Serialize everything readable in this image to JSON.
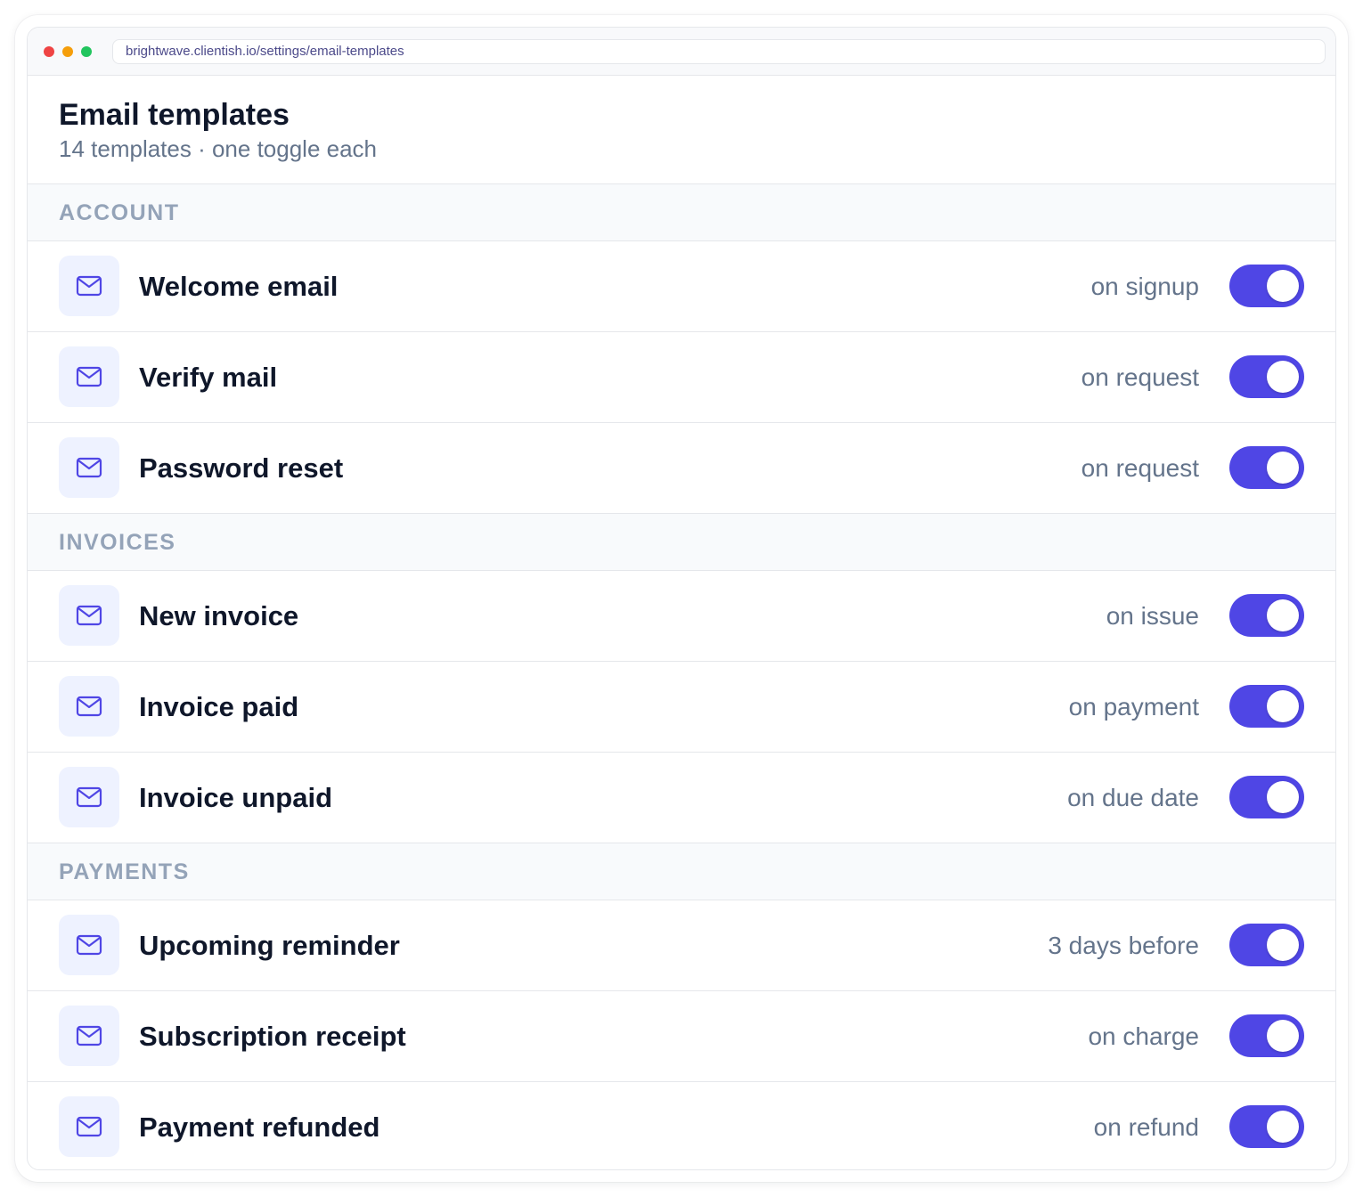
{
  "browser": {
    "url": "brightwave.clientish.io/settings/email-templates"
  },
  "page": {
    "title": "Email templates",
    "subtitle": "14 templates · one toggle each"
  },
  "sections": [
    {
      "name": "ACCOUNT",
      "templates": [
        {
          "name": "Welcome email",
          "trigger": "on signup",
          "enabled": true
        },
        {
          "name": "Verify mail",
          "trigger": "on request",
          "enabled": true
        },
        {
          "name": "Password reset",
          "trigger": "on request",
          "enabled": true
        }
      ]
    },
    {
      "name": "INVOICES",
      "templates": [
        {
          "name": "New invoice",
          "trigger": "on issue",
          "enabled": true
        },
        {
          "name": "Invoice paid",
          "trigger": "on payment",
          "enabled": true
        },
        {
          "name": "Invoice unpaid",
          "trigger": "on due date",
          "enabled": true
        }
      ]
    },
    {
      "name": "PAYMENTS",
      "templates": [
        {
          "name": "Upcoming reminder",
          "trigger": "3 days before",
          "enabled": true
        },
        {
          "name": "Subscription receipt",
          "trigger": "on charge",
          "enabled": true
        },
        {
          "name": "Payment refunded",
          "trigger": "on refund",
          "enabled": true
        }
      ]
    }
  ],
  "icons": {
    "template_icon": "mail-icon"
  },
  "colors": {
    "accent": "#4f46e5",
    "icon_bg": "#eef2ff",
    "muted_text": "#64748b",
    "section_text": "#94a3b8"
  }
}
